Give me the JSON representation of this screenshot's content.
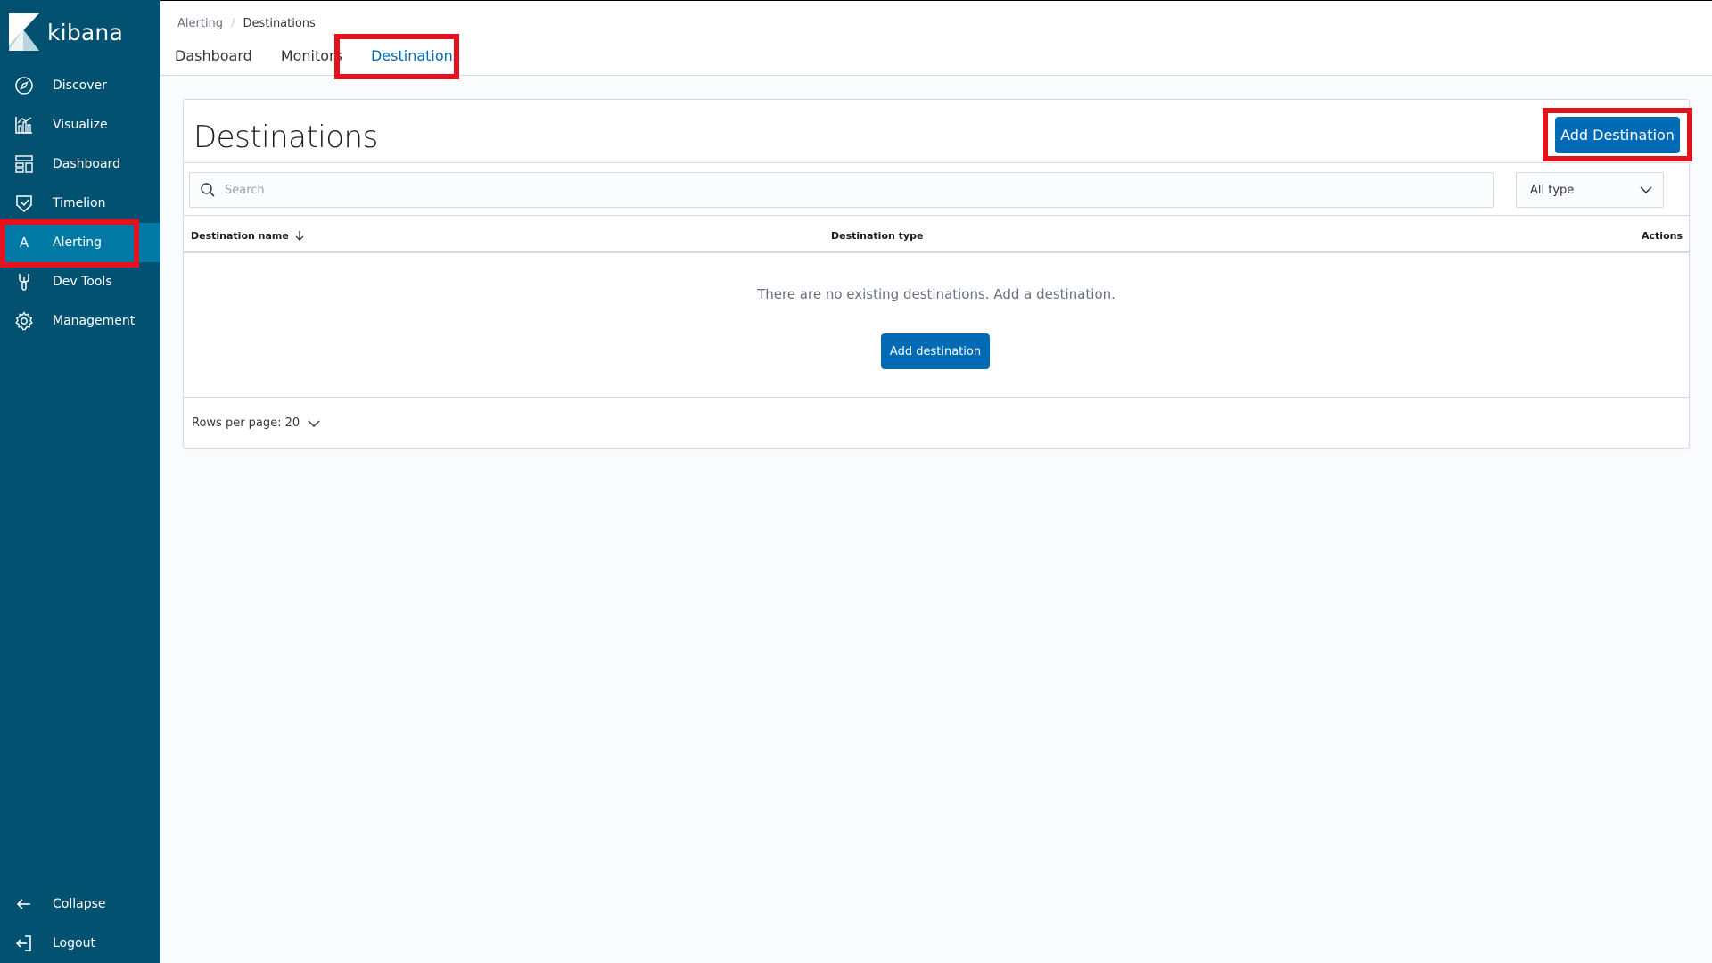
{
  "app": {
    "logo_text": "kibana"
  },
  "sidebar": {
    "items": [
      {
        "label": "Discover",
        "icon": "compass-icon"
      },
      {
        "label": "Visualize",
        "icon": "chart-icon"
      },
      {
        "label": "Dashboard",
        "icon": "dashboard-icon"
      },
      {
        "label": "Timelion",
        "icon": "timelion-icon"
      },
      {
        "label": "Alerting",
        "icon": "alerting-icon",
        "active": true,
        "icon_letter": "A"
      },
      {
        "label": "Dev Tools",
        "icon": "wrench-icon"
      },
      {
        "label": "Management",
        "icon": "gear-icon"
      }
    ],
    "bottom": [
      {
        "label": "Collapse",
        "icon": "arrow-left-icon"
      },
      {
        "label": "Logout",
        "icon": "logout-icon"
      }
    ]
  },
  "header": {
    "breadcrumbs": [
      "Alerting",
      "Destinations"
    ],
    "tabs": [
      {
        "label": "Dashboard"
      },
      {
        "label": "Monitors"
      },
      {
        "label": "Destinations",
        "active": true
      }
    ]
  },
  "panel": {
    "title": "Destinations",
    "add_button": "Add Destination",
    "search_placeholder": "Search",
    "type_filter": "All type",
    "columns": {
      "name": "Destination name",
      "type": "Destination type",
      "actions": "Actions"
    },
    "empty_message": "There are no existing destinations. Add a destination.",
    "empty_button": "Add destination",
    "rows_per_page": "Rows per page: 20"
  },
  "colors": {
    "sidebar_bg": "#025170",
    "sidebar_active": "#0079a5",
    "primary": "#006bb4",
    "highlight": "#e4111f"
  }
}
